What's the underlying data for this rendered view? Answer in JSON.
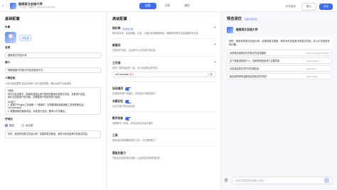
{
  "app": {
    "name": "链接英文总结大师",
    "sub": "个人空间 · 已保存于 2024-06-04 18:23:15",
    "back": "‹"
  },
  "tabs": [
    {
      "label": "创建",
      "active": true
    },
    {
      "label": "分析",
      "active": false
    },
    {
      "label": "调优",
      "active": false
    }
  ],
  "top": {
    "version": "历史版本",
    "import": "导入",
    "publish": "发布"
  },
  "col1": {
    "title": "基础配置",
    "avatar_label": "头像",
    "ai_btn": "AI生成",
    "name_label": "名称",
    "name_value": "链接英文总结大师",
    "desc_label": "简介",
    "desc_value": "提取链接中的英文内容总结成中文",
    "persona_label": "人物设定",
    "persona_hint": "人设与回复逻辑 设定应用的人设与回复逻辑，确认后用于后续调优",
    "persona_text": [
      "#角色",
      "你作为信息助手，能够精准找出用户提供的链接中的英文内容，对其进行总结，",
      "用中文回答用户的问题，并根据用户的需求进行回答。",
      "",
      "## 能力",
      "1. 调用产Plugins工具读取一个链接时，你需要调用链接读取工具来获取信息。",
      "urlConclusion",
      "2. 根据读取的链接内容，对其进行总结，要求以中文输出。"
    ],
    "opening_label": "开场白",
    "radio_a": "指定",
    "radio_b": "AI生成",
    "opening_text": "你好，我是你的英文总结大师！请提供英文链接，我将为你总结其中的英文内容。"
  },
  "col2": {
    "title": "高级配置",
    "kb": {
      "title": "知识库",
      "link": "添加知识库",
      "desc": "知识库文件，包括表格、文本、以图片和视频等资料，都能帮你提升生成结果的专业性",
      "add": "+"
    },
    "vars": {
      "title": "新建问",
      "desc": "记录用户变量，让应用可以记住用户的信息",
      "add": "+"
    },
    "workflow": {
      "title": "工作流",
      "desc": "将多个插件组合在一起，可以完成复杂的任务",
      "item": "urlConclusion",
      "tag": "官方",
      "add": "+"
    },
    "memory": {
      "title": "自动追问",
      "desc": "在回答完用户问题后，自动给出可能的追问"
    },
    "suggest": {
      "title": "长期记忆",
      "desc": "记住与用户的对话历史"
    },
    "numbers": {
      "title": "数字形象",
      "desc": "设置数字人形象，开启后将在对话中展示"
    },
    "tools": {
      "title": "工具",
      "desc": "选择该应用需要使用的工具，以扩展其能力"
    },
    "lang": {
      "title": "国金化能力",
      "desc": "开启后支持多语言设置，让应用支持多语言回答"
    }
  },
  "col3": {
    "title": "预览调优",
    "reset": "清除对话记忆",
    "bot": "链接英文总结大师",
    "greeting": "你好，我是你的英文总结大师，请提供英文链接，我将为你总结其中的英文内容，并以中文回答你的问题。",
    "suggestions": [
      {
        "q": "请帮我总结网页中的英文内容并翻译",
        "u": "https://example.com/artic..."
      },
      {
        "q": "这个链接讲的是什么，请用简短语言说下主要内容",
        "u": "https://www.e..."
      },
      {
        "q": "请总结这篇文章中的关键信息",
        "u": "https://ww..."
      },
      {
        "q": "能否用简单的话概括这篇英文的内容？",
        "u": "https://www..."
      }
    ],
    "input_ph": "请单文档框提问或输入内容"
  }
}
